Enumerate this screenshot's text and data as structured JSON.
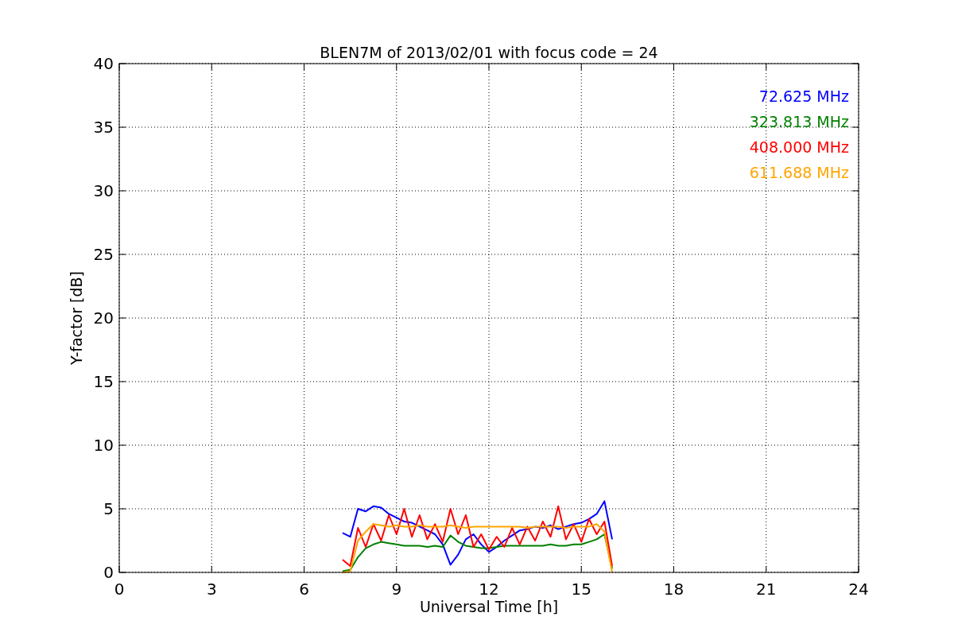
{
  "chart": {
    "chart_data": {
      "type": "line",
      "title": "BLEN7M of 2013/02/01 with focus code = 24",
      "xlabel": "Universal Time [h]",
      "ylabel": "Y-factor [dB]",
      "x": [
        7.25,
        7.5,
        7.75,
        8,
        8.25,
        8.5,
        8.75,
        9,
        9.25,
        9.5,
        9.75,
        10,
        10.25,
        10.5,
        10.75,
        11,
        11.25,
        11.5,
        11.75,
        12,
        12.25,
        12.5,
        12.75,
        13,
        13.25,
        13.5,
        13.75,
        14,
        14.25,
        14.5,
        14.75,
        15,
        15.25,
        15.5,
        15.75,
        16
      ],
      "series": [
        {
          "name": "72.625 MHz",
          "color": "#0000ff",
          "values": [
            3.1,
            2.8,
            5.0,
            4.8,
            5.2,
            5.1,
            4.6,
            4.3,
            4.0,
            3.9,
            3.6,
            3.3,
            3.0,
            2.2,
            0.6,
            1.4,
            2.6,
            3.0,
            2.2,
            1.6,
            2.0,
            2.5,
            2.9,
            3.3,
            3.4,
            3.6,
            3.5,
            3.7,
            3.4,
            3.6,
            3.8,
            3.9,
            4.2,
            4.6,
            5.6,
            2.6
          ]
        },
        {
          "name": "323.813 MHz",
          "color": "#008000",
          "values": [
            0.1,
            0.2,
            1.2,
            1.9,
            2.2,
            2.4,
            2.3,
            2.2,
            2.1,
            2.1,
            2.1,
            2.0,
            2.1,
            2.0,
            2.9,
            2.4,
            2.1,
            2.0,
            1.9,
            1.9,
            2.0,
            2.1,
            2.1,
            2.1,
            2.1,
            2.1,
            2.1,
            2.2,
            2.1,
            2.1,
            2.2,
            2.2,
            2.4,
            2.6,
            3.0,
            0.3
          ]
        },
        {
          "name": "408.000 MHz",
          "color": "#ff0000",
          "values": [
            1.0,
            0.5,
            3.5,
            2.0,
            3.8,
            2.5,
            4.5,
            3.0,
            5.0,
            2.8,
            4.5,
            2.6,
            3.8,
            2.4,
            5.0,
            3.0,
            4.5,
            2.0,
            3.0,
            1.8,
            2.8,
            2.0,
            3.5,
            2.2,
            3.6,
            2.5,
            4.0,
            2.8,
            5.2,
            2.6,
            3.8,
            2.4,
            4.2,
            3.0,
            4.0,
            0.5
          ]
        },
        {
          "name": "611.688 MHz",
          "color": "#ffa500",
          "values": [
            0.0,
            0.1,
            2.5,
            3.2,
            3.8,
            3.7,
            3.6,
            3.7,
            3.6,
            3.6,
            3.7,
            3.6,
            3.6,
            3.6,
            3.7,
            3.6,
            3.5,
            3.6,
            3.6,
            3.6,
            3.6,
            3.6,
            3.6,
            3.6,
            3.5,
            3.6,
            3.6,
            3.6,
            3.6,
            3.5,
            3.6,
            3.6,
            3.6,
            3.8,
            3.2,
            0.0
          ]
        }
      ],
      "xlim": [
        0,
        24
      ],
      "ylim": [
        0,
        40
      ],
      "xticks": [
        0,
        3,
        6,
        9,
        12,
        15,
        18,
        21,
        24
      ],
      "yticks": [
        0,
        5,
        10,
        15,
        20,
        25,
        30,
        35,
        40
      ],
      "grid": true
    }
  }
}
